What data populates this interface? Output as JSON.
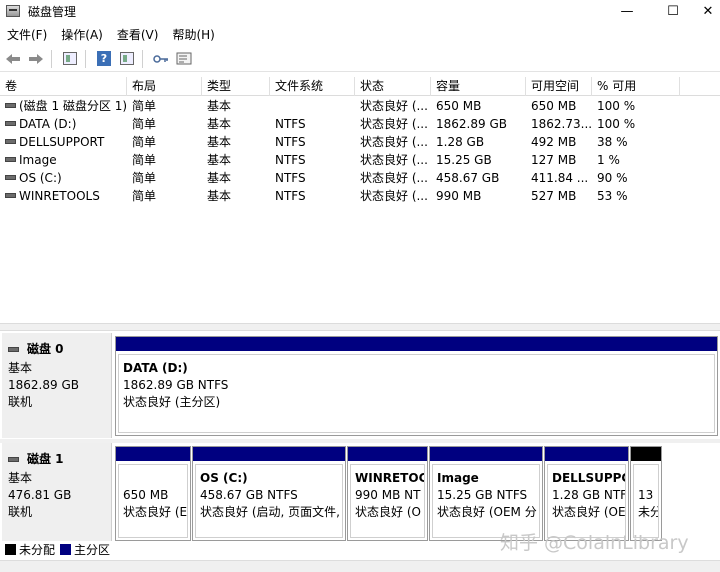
{
  "window": {
    "title": "磁盘管理",
    "min_glyph": "—",
    "max_glyph": "☐",
    "close_glyph": "✕"
  },
  "menu": [
    "文件(F)",
    "操作(A)",
    "查看(V)",
    "帮助(H)"
  ],
  "toolbar": {
    "back_icon": "arrow-left",
    "forward_icon": "arrow-right",
    "help_text": "?"
  },
  "table": {
    "columns": [
      "卷",
      "布局",
      "类型",
      "文件系统",
      "状态",
      "容量",
      "可用空间",
      "% 可用"
    ],
    "rows": [
      [
        "(磁盘 1 磁盘分区 1)",
        "简单",
        "基本",
        "",
        "状态良好 (...",
        "650 MB",
        "650 MB",
        "100 %"
      ],
      [
        "DATA (D:)",
        "简单",
        "基本",
        "NTFS",
        "状态良好 (...",
        "1862.89 GB",
        "1862.73...",
        "100 %"
      ],
      [
        "DELLSUPPORT",
        "简单",
        "基本",
        "NTFS",
        "状态良好 (...",
        "1.28 GB",
        "492 MB",
        "38 %"
      ],
      [
        "Image",
        "简单",
        "基本",
        "NTFS",
        "状态良好 (...",
        "15.25 GB",
        "127 MB",
        "1 %"
      ],
      [
        "OS (C:)",
        "简单",
        "基本",
        "NTFS",
        "状态良好 (...",
        "458.67 GB",
        "411.84 ...",
        "90 %"
      ],
      [
        "WINRETOOLS",
        "简单",
        "基本",
        "NTFS",
        "状态良好 (...",
        "990 MB",
        "527 MB",
        "53 %"
      ]
    ]
  },
  "disks": [
    {
      "name": "磁盘 0",
      "type": "基本",
      "size": "1862.89 GB",
      "status": "联机",
      "partitions": [
        {
          "name": "DATA  (D:)",
          "size": "1862.89 GB NTFS",
          "status": "状态良好 (主分区)",
          "kind": "primary"
        }
      ]
    },
    {
      "name": "磁盘 1",
      "type": "基本",
      "size": "476.81 GB",
      "status": "联机",
      "partitions": [
        {
          "name": "",
          "size": "650 MB",
          "status": "状态良好 (E",
          "kind": "primary"
        },
        {
          "name": "OS  (C:)",
          "size": "458.67 GB NTFS",
          "status": "状态良好 (启动, 页面文件,",
          "kind": "primary"
        },
        {
          "name": "WINRETOC",
          "size": "990 MB NT",
          "status": "状态良好 (O",
          "kind": "primary"
        },
        {
          "name": "Image",
          "size": "15.25 GB NTFS",
          "status": "状态良好 (OEM 分",
          "kind": "primary"
        },
        {
          "name": "DELLSUPPC",
          "size": "1.28 GB NTF",
          "status": "状态良好 (OE",
          "kind": "primary"
        },
        {
          "name": "",
          "size": "13",
          "status": "未分",
          "kind": "unallocated"
        }
      ]
    }
  ],
  "legend": [
    {
      "label": "未分配",
      "color": "#000000"
    },
    {
      "label": "主分区",
      "color": "#000080"
    }
  ],
  "watermark": "知乎 @ColalnLibrary",
  "colors": {
    "primary_partition": "#000080",
    "unallocated": "#000000"
  }
}
